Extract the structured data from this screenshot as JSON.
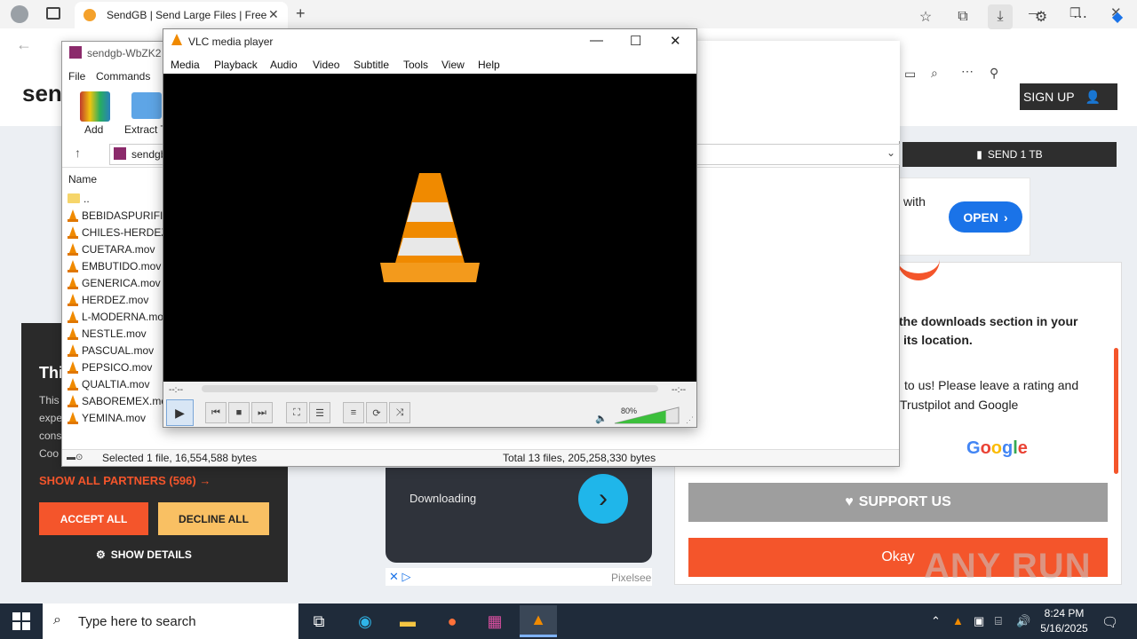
{
  "browser": {
    "tab_title": "SendGB | Send Large Files | Free f",
    "downloads_icon": "download-icon"
  },
  "site": {
    "logo": "sen",
    "signup": "SIGN UP",
    "send_1tb": "SEND 1 TB",
    "ad_with": "with",
    "open": "OPEN",
    "downloads_line1": "the downloads section in your",
    "downloads_line2": "its location.",
    "rate_line1": "to us! Please leave a rating and",
    "rate_line2": "Trustpilot and Google",
    "google": "Google",
    "support": "SUPPORT US",
    "okay": "Okay",
    "dl_ad_text": "Downloading",
    "pixelsee": "Pixelsee",
    "watermark": "ANY RUN"
  },
  "consent": {
    "title": "Thi",
    "lines": [
      "This",
      "expe",
      "cons",
      "Coo"
    ],
    "partners": "SHOW ALL PARTNERS (596) →",
    "accept": "ACCEPT ALL",
    "decline": "DECLINE ALL",
    "details": "SHOW DETAILS"
  },
  "winrar": {
    "title": "sendgb-WbZK2",
    "menu": [
      "File",
      "Commands"
    ],
    "add": "Add",
    "extract": "Extract T",
    "address": "sendgb",
    "col_name": "Name",
    "parent": "..",
    "files": [
      "BEBIDASPURIFICA",
      "CHILES-HERDEZ.m",
      "CUETARA.mov",
      "EMBUTIDO.mov",
      "GENERICA.mov",
      "HERDEZ.mov",
      "L-MODERNA.mov",
      "NESTLE.mov",
      "PASCUAL.mov",
      "PEPSICO.mov",
      "QUALTIA.mov",
      "SABOREMEX.mov",
      "YEMINA.mov"
    ],
    "status_selected": "Selected 1 file, 16,554,588 bytes",
    "status_total": "Total 13 files, 205,258,330 bytes"
  },
  "vlc": {
    "title": "VLC media player",
    "menu": [
      "Media",
      "Playback",
      "Audio",
      "Video",
      "Subtitle",
      "Tools",
      "View",
      "Help"
    ],
    "time_elapsed": "--:--",
    "time_total": "--:--",
    "volume": "80%",
    "volume_fraction": 0.8
  },
  "taskbar": {
    "search_placeholder": "Type here to search",
    "time": "8:24 PM",
    "date": "5/16/2025"
  }
}
